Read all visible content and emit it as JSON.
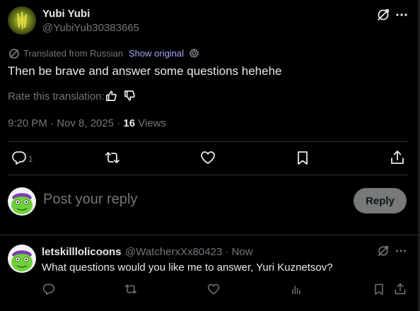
{
  "tweet": {
    "author_name": "Yubi Yubi",
    "author_handle": "@YubiYub30383665",
    "translated_label": "Translated from Russian",
    "show_original": "Show original",
    "text": "Then be brave and answer some questions hehehe",
    "rate_label": "Rate this translation:",
    "time": "9:20 PM · Nov 8, 2025 · ",
    "views_count": "16",
    "views_label": " Views",
    "reply_count": "1"
  },
  "compose": {
    "placeholder": "Post your reply",
    "reply_button": "Reply"
  },
  "reply_tweet": {
    "author_name": "letskilllolicoons",
    "author_handle": "@WatcherxXx80423 · Now",
    "text": "What questions would you like me to answer, Yuri Kuznetsov?"
  },
  "icons": {
    "grok": "grok-icon",
    "more": "more-icon",
    "translate": "translate-icon",
    "settings": "gear-icon",
    "thumb_up": "thumb-up-icon",
    "thumb_down": "thumb-down-icon",
    "reply": "reply-icon",
    "retweet": "retweet-icon",
    "like": "heart-icon",
    "bookmark": "bookmark-icon",
    "share": "share-icon",
    "analytics": "analytics-icon"
  },
  "colors": {
    "background": "#000000",
    "text_primary": "#e7e9ea",
    "text_secondary": "#71767b",
    "link": "#a8a8ff",
    "reply_button": "#787a7a",
    "divider": "#2f3336"
  }
}
